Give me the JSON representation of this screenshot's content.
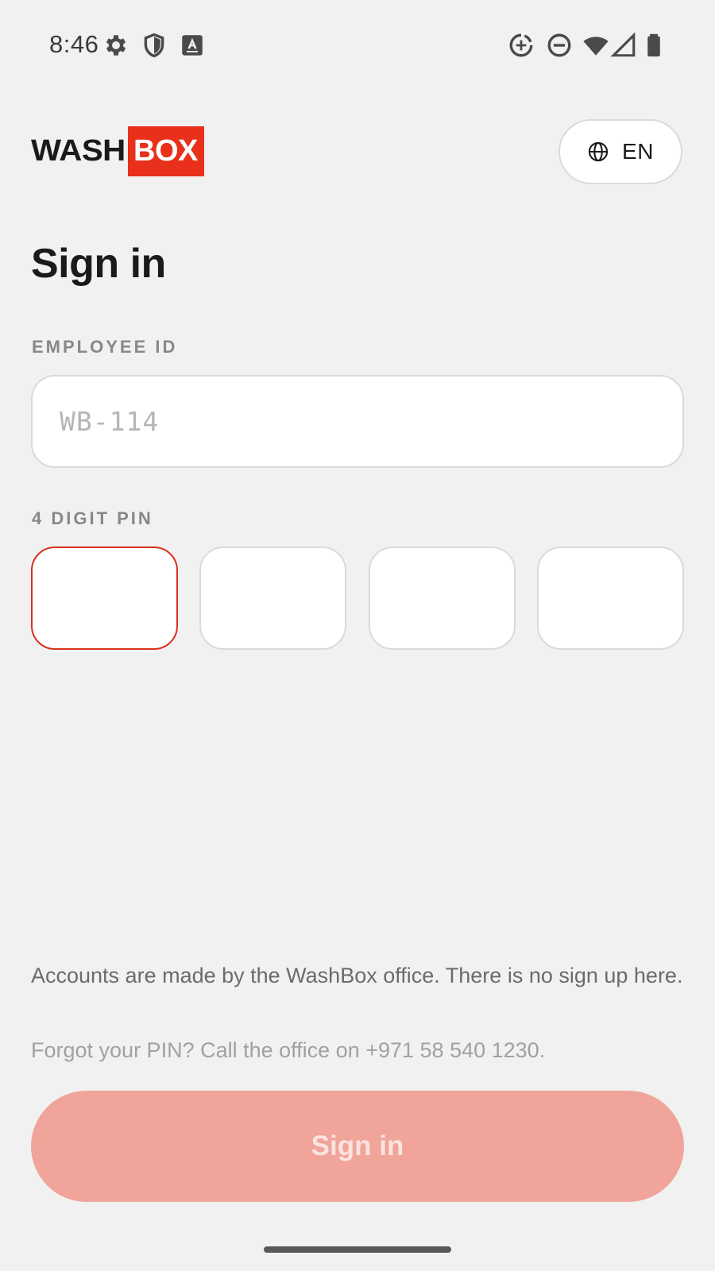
{
  "status_bar": {
    "time": "8:46",
    "left_icons": [
      "settings-gear-icon",
      "shield-icon",
      "font-a-icon"
    ],
    "right_icons": [
      "data-saver-icon",
      "do-not-disturb-icon",
      "wifi-icon",
      "signal-icon",
      "battery-icon"
    ]
  },
  "header": {
    "logo_part1": "WASH",
    "logo_part2": "BOX",
    "logo_accent_color": "#e8301a",
    "language_label": "EN"
  },
  "form": {
    "title": "Sign in",
    "employee_id_label": "EMPLOYEE ID",
    "employee_id_placeholder": "WB-114",
    "employee_id_value": "",
    "pin_label": "4 DIGIT PIN",
    "pin_digits": [
      "",
      "",
      "",
      ""
    ],
    "pin_focused_index": 0
  },
  "footer": {
    "info": "Accounts are made by the WashBox office. There is no sign up here.",
    "forgot": "Forgot your PIN? Call the office on +971 58 540 1230.",
    "submit_label": "Sign in",
    "submit_color": "#f0a49a"
  }
}
